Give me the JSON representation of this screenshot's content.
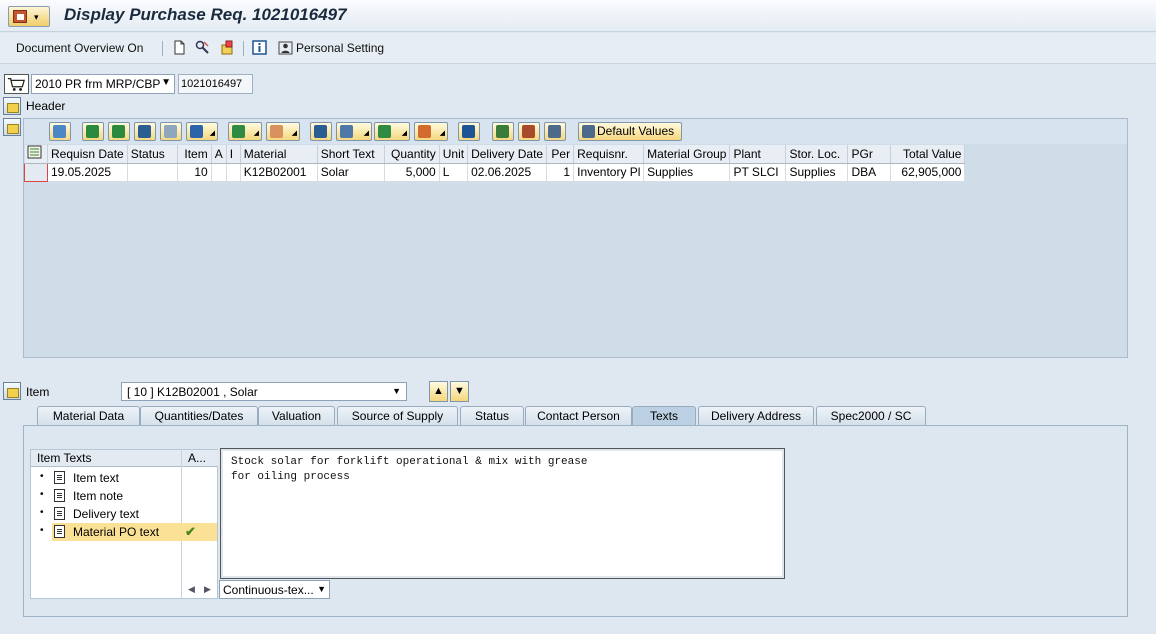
{
  "title": "Display Purchase Req. 1021016497",
  "toolbar": {
    "doc_overview": "Document Overview On",
    "personal_setting": "Personal Setting"
  },
  "doc": {
    "type": "2010 PR frm MRP/CBP",
    "number": "1021016497"
  },
  "header_label": "Header",
  "grid": {
    "default_values": "Default Values",
    "columns": [
      "Requisn Date",
      "Status",
      "Item",
      "A",
      "I",
      "Material",
      "Short Text",
      "Quantity",
      "Unit",
      "Delivery Date",
      "Per",
      "Requisnr.",
      "Material Group",
      "Plant",
      "Stor. Loc.",
      "PGr",
      "Total Value"
    ],
    "rows": [
      [
        "19.05.2025",
        "",
        "10",
        "",
        "",
        "K12B02001",
        "Solar",
        "5,000",
        "L",
        "02.06.2025",
        "1",
        "Inventory Pl",
        "Supplies",
        "PT SLCI",
        "Supplies",
        "DBA",
        "62,905,000"
      ]
    ]
  },
  "item": {
    "label": "Item",
    "selected": "[ 10 ] K12B02001 , Solar"
  },
  "tabs": [
    "Material Data",
    "Quantities/Dates",
    "Valuation",
    "Source of Supply",
    "Status",
    "Contact Person",
    "Texts",
    "Delivery Address",
    "Spec2000 / SC"
  ],
  "active_tab": "Texts",
  "texts": {
    "tree_header": "Item Texts",
    "col2_header": "A...",
    "items": [
      "Item text",
      "Item note",
      "Delivery text",
      "Material PO text"
    ],
    "selected_index": 3,
    "content_line1": "Stock solar for forklift operational & mix with grease",
    "content_line2": "for oiling process",
    "format": "Continuous-tex..."
  }
}
